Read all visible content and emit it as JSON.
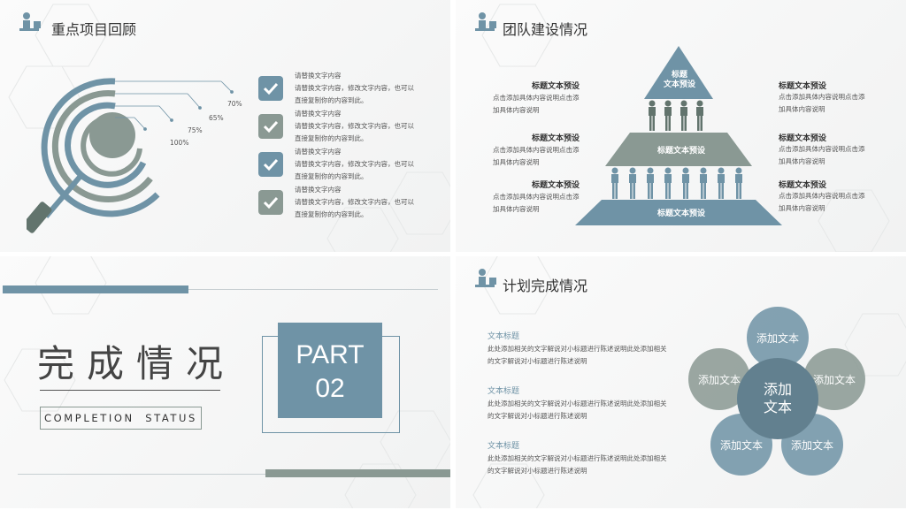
{
  "colors": {
    "blue": "#6f93a6",
    "gray": "#8a9993",
    "dark": "#62746d",
    "text": "#333333"
  },
  "slide1": {
    "title": "重点项目回顾",
    "percents": [
      "70%",
      "65%",
      "75%",
      "100%"
    ],
    "items": [
      {
        "head": "请替换文字内容",
        "line1": "请替换文字内容，修改文字内容，也可以",
        "line2": "直接复制你的内容到此。"
      },
      {
        "head": "请替换文字内容",
        "line1": "请替换文字内容，修改文字内容，也可以",
        "line2": "直接复制你的内容到此。"
      },
      {
        "head": "请替换文字内容",
        "line1": "请替换文字内容，修改文字内容，也可以",
        "line2": "直接复制你的内容到此。"
      },
      {
        "head": "请替换文字内容",
        "line1": "请替换文字内容，修改文字内容，也可以",
        "line2": "直接复制你的内容到此。"
      }
    ]
  },
  "slide2": {
    "title": "团队建设情况",
    "pyramid": {
      "top": "标题\n文本预设",
      "mid": "标题文本预设",
      "base": "标题文本预设"
    },
    "left": [
      {
        "head": "标题文本预设",
        "line1": "点击添加具体内容说明点击添",
        "line2": "加具体内容说明"
      },
      {
        "head": "标题文本预设",
        "line1": "点击添加具体内容说明点击添",
        "line2": "加具体内容说明"
      },
      {
        "head": "标题文本预设",
        "line1": "点击添加具体内容说明点击添",
        "line2": "加具体内容说明"
      }
    ],
    "right": [
      {
        "head": "标题文本预设",
        "line1": "点击添加具体内容说明点击添",
        "line2": "加具体内容说明"
      },
      {
        "head": "标题文本预设",
        "line1": "点击添加具体内容说明点击添",
        "line2": "加具体内容说明"
      },
      {
        "head": "标题文本预设",
        "line1": "点击添加具体内容说明点击添",
        "line2": "加具体内容说明"
      }
    ]
  },
  "slide3": {
    "title": "完成情况",
    "subtitle": "COMPLETION  STATUS",
    "part": "PART",
    "num": "02"
  },
  "slide4": {
    "title": "计划完成情况",
    "items": [
      {
        "head": "文本标题",
        "line1": "此处添加相关的文字解说对小标题进行陈述说明此处添加相关",
        "line2": "的文字解说对小标题进行陈述说明"
      },
      {
        "head": "文本标题",
        "line1": "此处添加相关的文字解说对小标题进行陈述说明此处添加相关",
        "line2": "的文字解说对小标题进行陈述说明"
      },
      {
        "head": "文本标题",
        "line1": "此处添加相关的文字解说对小标题进行陈述说明此处添加相关",
        "line2": "的文字解说对小标题进行陈述说明"
      }
    ],
    "petals": [
      "添加文本",
      "添加文本",
      "添加文本",
      "添加文本",
      "添加文本"
    ],
    "center": "添加\n文本"
  }
}
